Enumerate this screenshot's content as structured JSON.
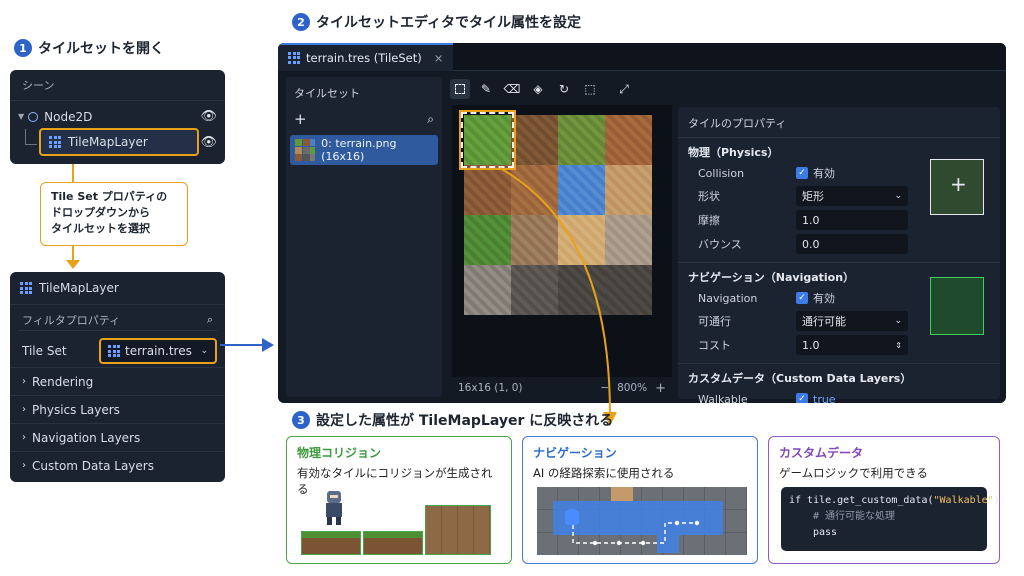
{
  "step1": {
    "number": "1",
    "title": "タイルセットを開く"
  },
  "step2": {
    "number": "2",
    "title": "タイルセットエディタでタイル属性を設定"
  },
  "step3": {
    "number": "3",
    "title": "設定した属性が TileMapLayer に反映される"
  },
  "scene_panel": {
    "title": "シーン",
    "node2d": "Node2D",
    "tilemaplayer": "TileMapLayer",
    "eye_icon": "eye-icon"
  },
  "callout": {
    "line1": "Tile Set プロパティの",
    "line2": "ドロップダウンから",
    "line3": "タイルセットを選択"
  },
  "inspector": {
    "title": "TileMapLayer",
    "filter_placeholder": "フィルタプロパティ",
    "tileset_label": "Tile Set",
    "tileset_value": "terrain.tres",
    "sections": [
      "Rendering",
      "Physics Layers",
      "Navigation Layers",
      "Custom Data Layers"
    ]
  },
  "editor": {
    "tab_label": "terrain.tres (TileSet)",
    "tileset_list_title": "タイルセット",
    "tileset_item": "0: terrain.png (16x16)",
    "status_coords": "16x16 (1, 0)",
    "zoom": "800%",
    "tools": [
      "select-tool-icon",
      "pencil-tool-icon",
      "eraser-tool-icon",
      "bucket-tool-icon",
      "rotate-tool-icon",
      "marquee-tool-icon",
      "expand-tool-icon"
    ]
  },
  "props": {
    "title": "タイルのプロパティ",
    "physics_title": "物理（Physics）",
    "collision_label": "Collision",
    "collision_value": "有効",
    "shape_label": "形状",
    "shape_value": "矩形",
    "friction_label": "摩擦",
    "friction_value": "1.0",
    "bounce_label": "バウンス",
    "bounce_value": "0.0",
    "nav_title": "ナビゲーション（Navigation）",
    "nav_label": "Navigation",
    "nav_value": "有効",
    "pass_label": "可通行",
    "pass_value": "通行可能",
    "cost_label": "コスト",
    "cost_value": "1.0",
    "custom_title": "カスタムデータ（Custom Data Layers）",
    "walkable_label": "Walkable",
    "walkable_value": "true"
  },
  "cards": {
    "physics": {
      "title": "物理コリジョン",
      "desc": "有効なタイルにコリジョンが生成される",
      "color": "#4aa64a"
    },
    "nav": {
      "title": "ナビゲーション",
      "desc": "AI の経路探索に使用される",
      "color": "#3f7fd8"
    },
    "custom": {
      "title": "カスタムデータ",
      "desc": "ゲームロジックで利用できる",
      "color": "#8e5cc8",
      "code_line1_a": "if tile.get_custom_data(",
      "code_line1_b": "\"Walkable\"",
      "code_line1_c": "):",
      "code_line2": "# 通行可能な処理",
      "code_line3": "pass"
    }
  },
  "colors": {
    "accent": "#2e63c8",
    "highlight": "#e8a21a",
    "panel": "#1b2230"
  }
}
